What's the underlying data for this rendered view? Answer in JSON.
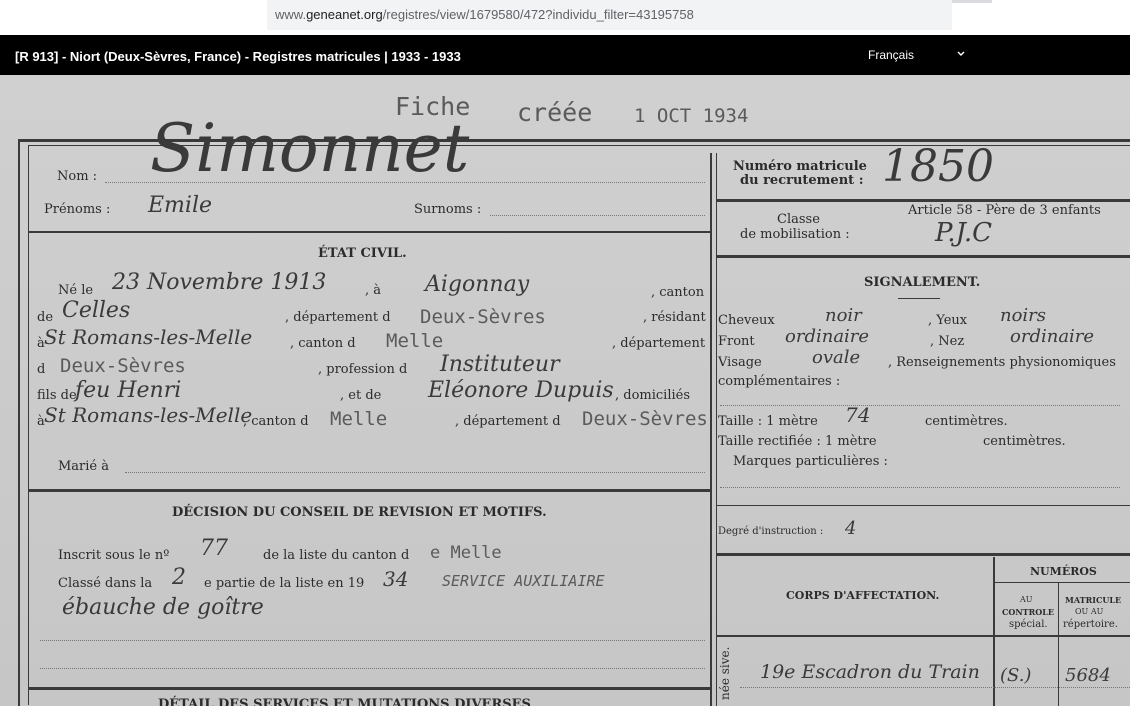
{
  "browser": {
    "url_prefix": "www.",
    "url_host": "geneanet.org",
    "url_path": "/registres/view/1679580/472?individu_filter=43195758"
  },
  "header": {
    "title": "[R 913] - Niort (Deux-Sèvres, France) - Registres matricules | 1933 - 1933",
    "language": "Français"
  },
  "document": {
    "stamp_fiche": "Fiche",
    "stamp_creee": "créée",
    "stamp_date": "1 OCT 1934",
    "nom_label": "Nom :",
    "nom_value": "Simonnet",
    "prenoms_label": "Prénoms :",
    "prenoms_value": "Emile",
    "surnoms_label": "Surnoms :",
    "numero_label_1": "Numéro matricule",
    "numero_label_2": "du recrutement :",
    "numero_value": "1850",
    "classe_label_1": "Classe",
    "classe_label_2": "de mobilisation :",
    "classe_note": "Article 58 - Père de 3 enfants",
    "classe_value": "P.J.C",
    "etat_civil": "ÉTAT CIVIL.",
    "ne_le": "Né le",
    "birth_date": "23 Novembre 1913",
    "birth_a": ", à",
    "birth_place": "Aigonnay",
    "canton": ", canton",
    "de": "de",
    "canton_value": "Celles",
    "departement_d": ", département d",
    "departement_value": "Deux-Sèvres",
    "resident": ", résidant",
    "a": "à",
    "residence": "St Romans-les-Melle",
    "canton_d": ", canton d",
    "residence_canton": "Melle",
    "departement": ", département",
    "d": "d",
    "residence_dept": "Deux-Sèvres",
    "profession_label": ", profession d",
    "profession": "Instituteur",
    "fils_de": "fils de",
    "father": "feu Henri",
    "et_de": ", et de",
    "mother": "Eléonore Dupuis",
    "domicilies": ", domiciliés",
    "parents_place": "St Romans-les-Melle",
    "parents_canton_label": ", canton d",
    "parents_canton": "Melle",
    "parents_dept_label": ", département d",
    "parents_dept": "Deux-Sèvres",
    "marie_label": "Marié à",
    "decision_title": "DÉCISION DU CONSEIL DE REVISION ET MOTIFS.",
    "inscrit_label": "Inscrit sous le nº",
    "inscrit_no": "77",
    "liste_canton": "de la liste du canton d",
    "liste_canton_value": "e Melle",
    "classe_dans": "Classé dans la",
    "partie_no": "2",
    "partie_label": "e partie de la liste en 19",
    "annee": "34",
    "service": "SERVICE AUXILIAIRE",
    "motif": "ébauche de goître",
    "detail_title": "DÉTAIL DES SERVICES ET MUTATIONS DIVERSES",
    "signalement": "SIGNALEMENT.",
    "cheveux_label": "Cheveux",
    "cheveux": "noir",
    "yeux_label": ", Yeux",
    "yeux": "noirs",
    "front_label": "Front",
    "front": "ordinaire",
    "nez_label": ", Nez",
    "nez": "ordinaire",
    "visage_label": "Visage",
    "visage": "ovale",
    "renseignements": ", Renseignements physionomiques",
    "complementaires": "complémentaires :",
    "taille_label": "Taille : 1 mètre",
    "taille": "74",
    "centimetres": "centimètres.",
    "taille_rect": "Taille rectifiée : 1 mètre",
    "centimetres2": "centimètres.",
    "marques": "Marques particulières :",
    "degre_label": "Degré d'instruction :",
    "degre": "4",
    "corps": "CORPS D'AFFECTATION.",
    "numeros": "NUMÉROS",
    "au_controle_1": "AU",
    "au_controle_2": "CONTROLE",
    "au_controle_3": "spécial.",
    "matricule_1": "MATRICULE",
    "matricule_2": "OU AU",
    "matricule_3": "répertoire.",
    "corps_value": "19e Escadron du Train",
    "controle_value": "(S.)",
    "matricule_value": "5684",
    "side_label": "née sive."
  }
}
